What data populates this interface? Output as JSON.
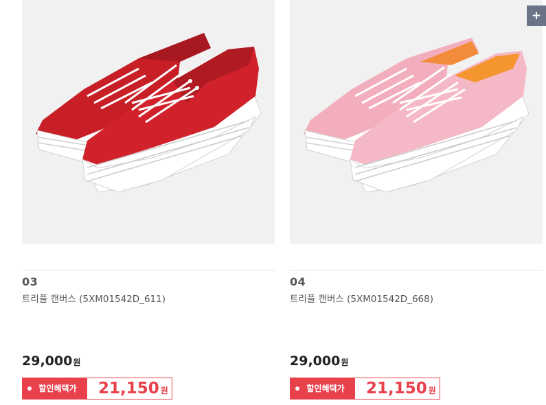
{
  "products": [
    {
      "number": "03",
      "name": "트리플 캔버스 (5XM01542D_611)",
      "price": "29,000",
      "price_unit": "원",
      "discount_label": "할인혜택가",
      "discount_price": "21,150",
      "discount_unit": "원",
      "shoe_color": "#d1222b",
      "image_icon": "red-sneaker-image"
    },
    {
      "number": "04",
      "name": "트리플 캔버스 (5XM01542D_668)",
      "price": "29,000",
      "price_unit": "원",
      "discount_label": "할인혜택가",
      "discount_price": "21,150",
      "discount_unit": "원",
      "shoe_color": "#f5b8c6",
      "image_icon": "pink-sneaker-image"
    }
  ],
  "floating_button": {
    "label": "+",
    "icon": "plus-icon"
  },
  "colors": {
    "accent": "#e8414c",
    "panel": "#f1f1f1",
    "side_button": "#6b7486"
  }
}
